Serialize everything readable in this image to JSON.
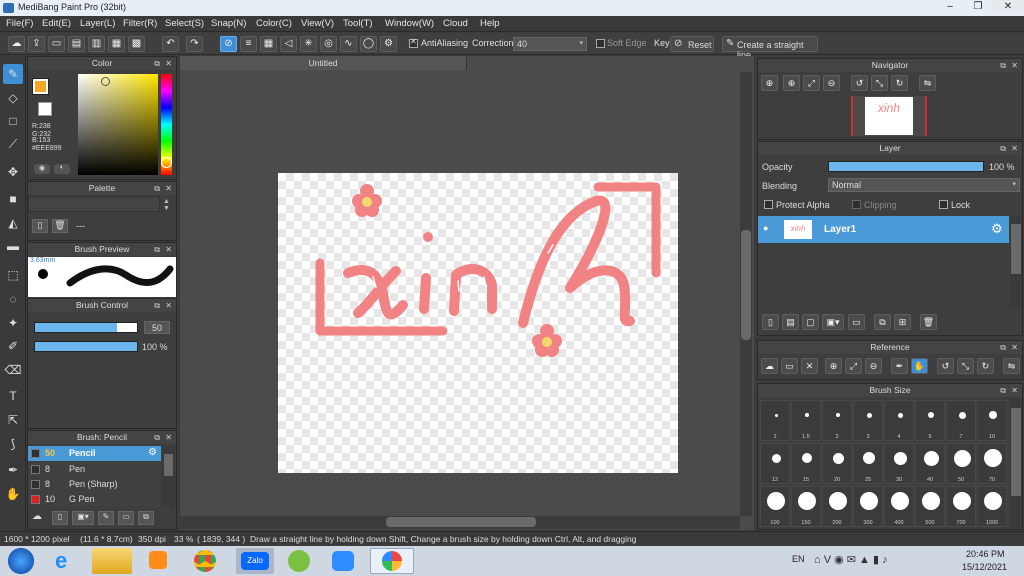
{
  "window": {
    "title": "MediBang Paint Pro (32bit)"
  },
  "menu": [
    "File(F)",
    "Edit(E)",
    "Layer(L)",
    "Filter(R)",
    "Select(S)",
    "Snap(N)",
    "Color(C)",
    "View(V)",
    "Tool(T)",
    "Window(W)",
    "Cloud",
    "Help"
  ],
  "toolbar": {
    "antialias_label": "AntiAliasing",
    "correction_label": "Correction",
    "correction_value": "40",
    "softedge_label": "Soft Edge",
    "key_label": "Key",
    "reset_label": "Reset",
    "straight_label": "Create a straight line"
  },
  "color_panel": {
    "title": "Color",
    "r": "R:238",
    "g": "G:232",
    "b": "B:153",
    "hex": "#EEE899",
    "fg": "#f5a623",
    "bg": "#ffffff"
  },
  "palette_panel": {
    "title": "Palette",
    "text": "---"
  },
  "brush_preview": {
    "title": "Brush Preview",
    "size": "3.63mm"
  },
  "brush_control": {
    "title": "Brush Control",
    "size": "50",
    "opacity": "100 %",
    "size_frac": 0.8,
    "opacity_frac": 1.0
  },
  "brush_list": {
    "title": "Brush: Pencil",
    "items": [
      {
        "num": "50",
        "name": "Pencil",
        "color": "#2f2f2f",
        "active": true
      },
      {
        "num": "8",
        "name": "Pen",
        "color": "#2f2f2f"
      },
      {
        "num": "8",
        "name": "Pen (Sharp)",
        "color": "#2f2f2f"
      },
      {
        "num": "10",
        "name": "G Pen",
        "color": "#e02020"
      }
    ]
  },
  "document": {
    "tab": "Untitled"
  },
  "artwork": {
    "text": "xinh",
    "color": "#f18384"
  },
  "navigator": {
    "title": "Navigator"
  },
  "layer_panel": {
    "title": "Layer",
    "opacity_label": "Opacity",
    "opacity_value": "100 %",
    "opacity_frac": 1.0,
    "blending_label": "Blending",
    "blending_value": "Normal",
    "protect_label": "Protect Alpha",
    "clipping_label": "Clipping",
    "lock_label": "Lock",
    "layer_name": "Layer1"
  },
  "reference": {
    "title": "Reference"
  },
  "brush_size": {
    "title": "Brush Size",
    "sizes": [
      "1",
      "1.5",
      "2",
      "3",
      "4",
      "5",
      "7",
      "10",
      "12",
      "15",
      "20",
      "25",
      "30",
      "40",
      "50",
      "70",
      "100",
      "150",
      "200",
      "300",
      "400",
      "500",
      "700",
      "1000"
    ]
  },
  "status": {
    "dims": "1600 * 1200 pixel",
    "physical": "(11.6 * 8.7cm)",
    "dpi": "350 dpi",
    "zoom": "33 %",
    "coords": "( 1839, 344 )",
    "hint": "Draw a straight line by holding down Shift, Change a brush size by holding down Ctrl, Alt, and dragging"
  },
  "taskbar": {
    "lang": "EN",
    "time": "20:46 PM",
    "date": "15/12/2021",
    "apps": [
      "windows-start",
      "ie",
      "explorer",
      "media",
      "chrome",
      "zalo",
      "app-green",
      "zoom",
      "medibang"
    ]
  }
}
